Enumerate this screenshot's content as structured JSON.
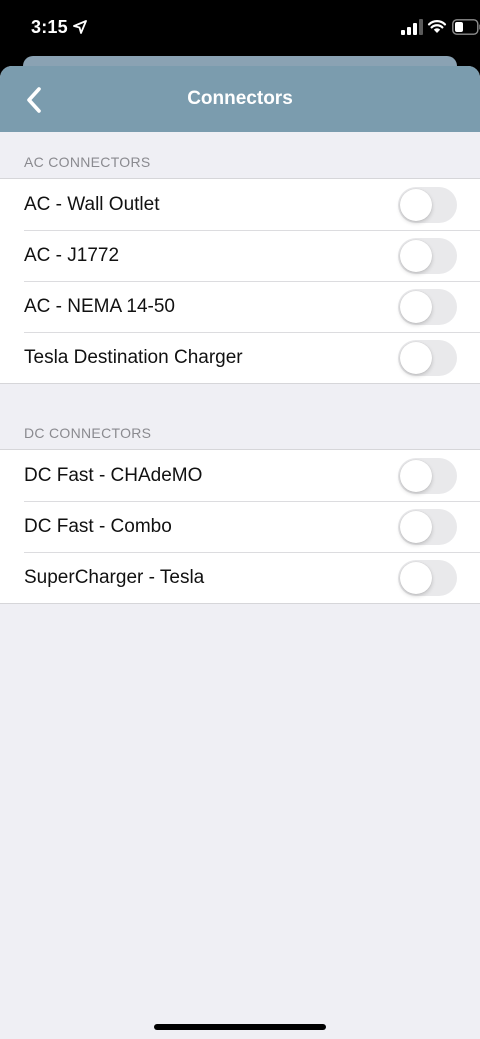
{
  "status_bar": {
    "time": "3:15",
    "icons": [
      "location-arrow-icon",
      "cellular-signal-icon",
      "wifi-icon",
      "battery-icon"
    ]
  },
  "nav": {
    "title": "Connectors",
    "back_icon": "chevron-left-icon",
    "color": "#7b9cae"
  },
  "sections": [
    {
      "header": "AC CONNECTORS",
      "items": [
        {
          "label": "AC - Wall Outlet",
          "enabled": false
        },
        {
          "label": "AC - J1772",
          "enabled": false
        },
        {
          "label": "AC - NEMA 14-50",
          "enabled": false
        },
        {
          "label": "Tesla Destination Charger",
          "enabled": false
        }
      ]
    },
    {
      "header": "DC CONNECTORS",
      "items": [
        {
          "label": "DC Fast - CHAdeMO",
          "enabled": false
        },
        {
          "label": "DC Fast - Combo",
          "enabled": false
        },
        {
          "label": "SuperCharger - Tesla",
          "enabled": false
        }
      ]
    }
  ]
}
